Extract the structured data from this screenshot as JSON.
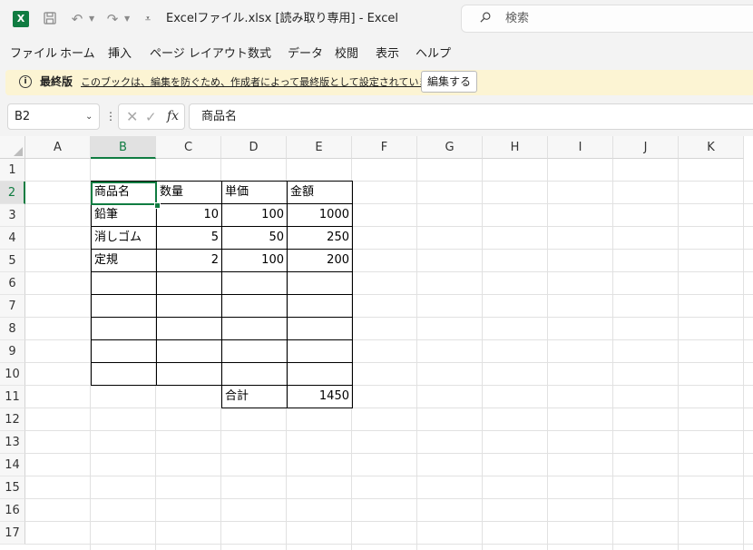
{
  "app": {
    "logo_letter": "X",
    "title": "Excelファイル.xlsx  [読み取り専用]  -  Excel",
    "search_placeholder": "検索",
    "accent_color": "#107c41"
  },
  "menu": [
    "ファイル",
    "ホーム",
    "挿入",
    "ページ レイアウト",
    "数式",
    "データ",
    "校閲",
    "表示",
    "ヘルプ"
  ],
  "message_bar": {
    "title": "最終版",
    "text": "このブックは、編集を防ぐため、作成者によって最終版として設定されています。",
    "button": "編集する",
    "background": "#fcf4d3"
  },
  "formula_bar": {
    "name_box": "B2",
    "fx": "fx",
    "content": "商品名"
  },
  "sheet": {
    "columns": [
      "A",
      "B",
      "C",
      "D",
      "E",
      "F",
      "G",
      "H",
      "I",
      "J",
      "K"
    ],
    "rows": [
      "1",
      "2",
      "3",
      "4",
      "5",
      "6",
      "7",
      "8",
      "9",
      "10",
      "11",
      "12",
      "13",
      "14",
      "15",
      "16",
      "17"
    ],
    "selected_cell": "B2",
    "cells": {
      "B2": "商品名",
      "C2": "数量",
      "D2": "単価",
      "E2": "金額",
      "B3": "鉛筆",
      "C3": "10",
      "D3": "100",
      "E3": "1000",
      "B4": "消しゴム",
      "C4": "5",
      "D4": "50",
      "E4": "250",
      "B5": "定規",
      "C5": "2",
      "D5": "100",
      "E5": "200",
      "D11": "合計",
      "E11": "1450"
    }
  }
}
